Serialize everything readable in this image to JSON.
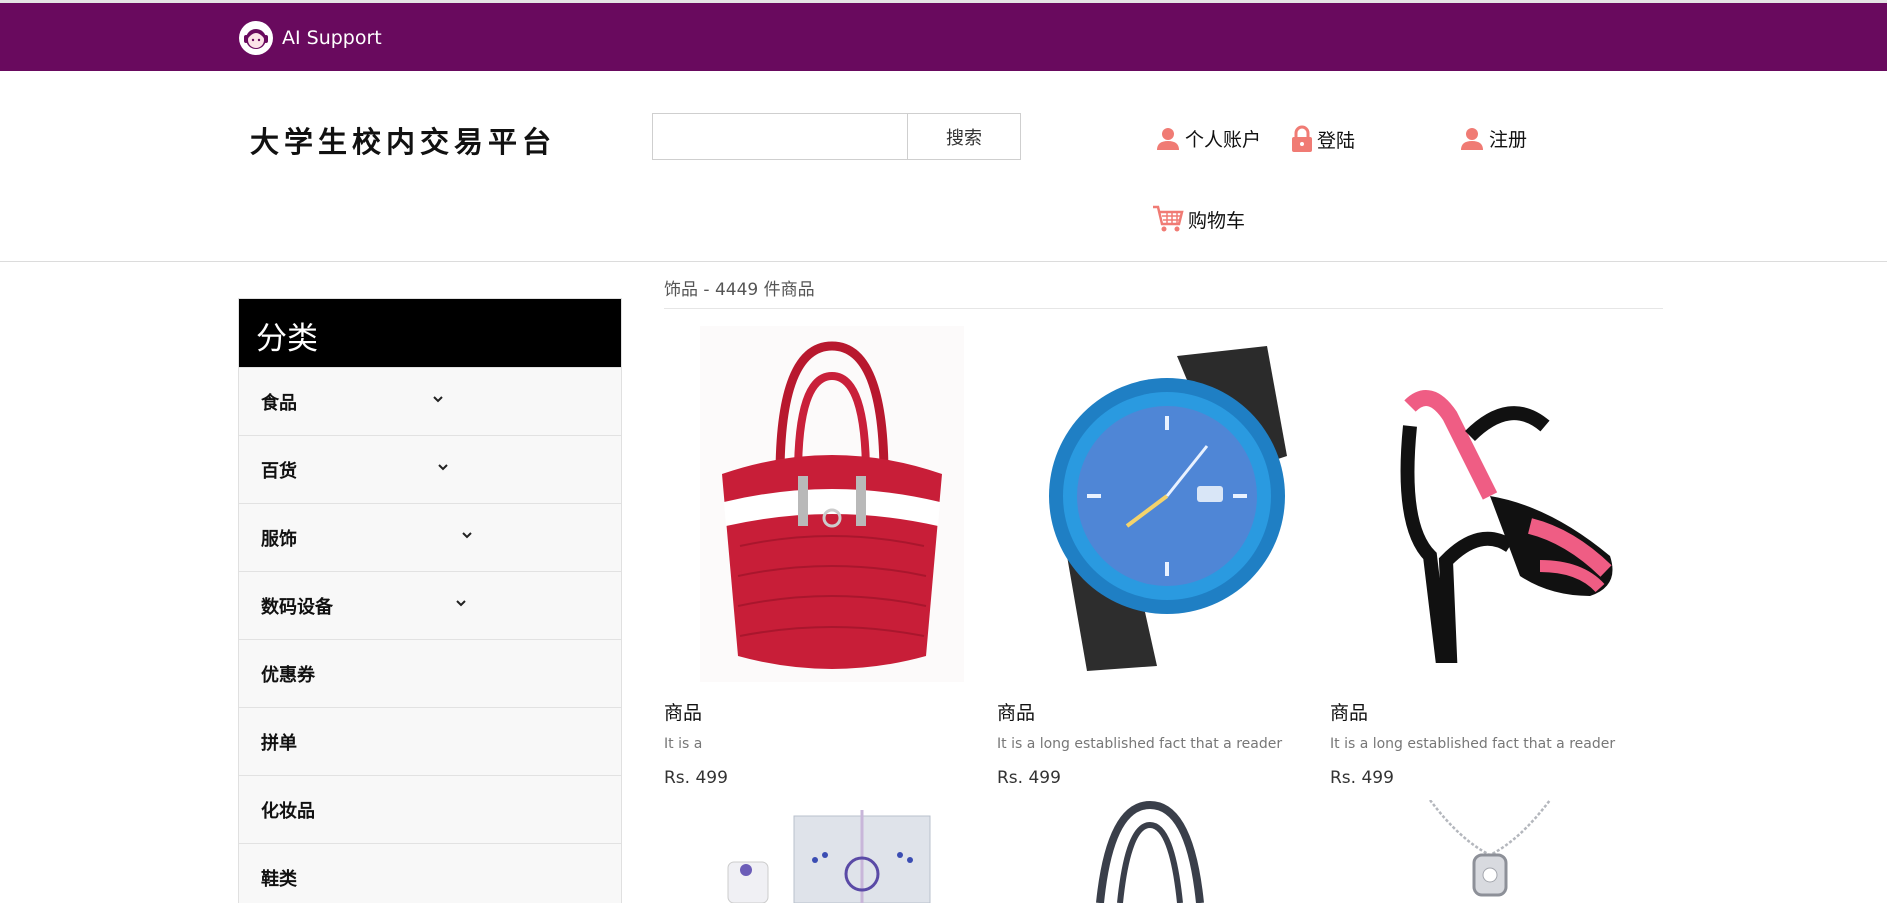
{
  "support": {
    "label": "AI Support",
    "icon": "headset-avatar-icon"
  },
  "site": {
    "title": "大学生校内交易平台"
  },
  "search": {
    "value": "",
    "placeholder": "",
    "button_label": "搜索"
  },
  "nav": {
    "account_label": "个人账户",
    "login_label": "登陆",
    "register_label": "注册",
    "cart_label": "购物车"
  },
  "colors": {
    "topbar": "#690a5e",
    "accent_icon": "#f07b74"
  },
  "sidebar": {
    "title": "分类",
    "categories": [
      {
        "label": "食品",
        "has_dropdown": true
      },
      {
        "label": "百货",
        "has_dropdown": true
      },
      {
        "label": "服饰",
        "has_dropdown": true
      },
      {
        "label": "数码设备",
        "has_dropdown": true
      },
      {
        "label": "优惠券",
        "has_dropdown": false
      },
      {
        "label": "拼单",
        "has_dropdown": false
      },
      {
        "label": "化妆品",
        "has_dropdown": false
      },
      {
        "label": "鞋类",
        "has_dropdown": false
      }
    ]
  },
  "listing": {
    "breadcrumb": "饰品 - 4449 件商品"
  },
  "products": [
    {
      "name": "商品",
      "description": "It is a",
      "price": "Rs. 499",
      "image": "red-handbag"
    },
    {
      "name": "商品",
      "description": "It is a long established fact that a reader",
      "price": "Rs. 499",
      "image": "blue-watch"
    },
    {
      "name": "商品",
      "description": "It is a long established fact that a reader",
      "price": "Rs. 499",
      "image": "pink-heel-sandal"
    }
  ],
  "more_products": [
    {
      "image": "perfume-gift-box"
    },
    {
      "image": "black-handbag"
    },
    {
      "image": "silver-necklace"
    }
  ]
}
